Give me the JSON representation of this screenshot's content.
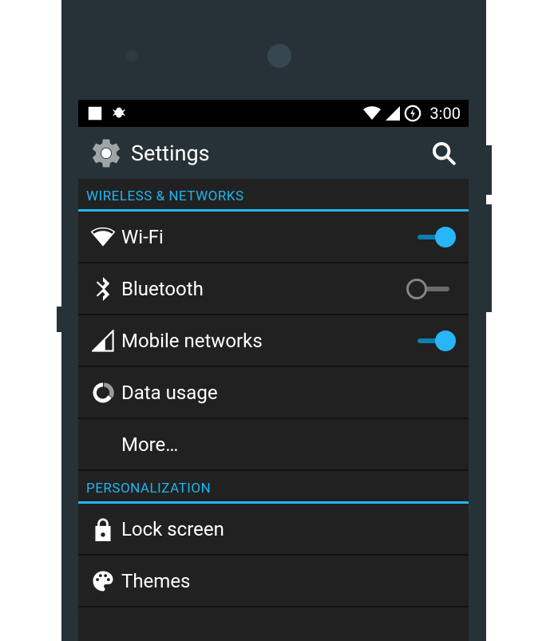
{
  "status_bar": {
    "time": "3:00",
    "icons": {
      "image": "image-icon",
      "debug": "bug-icon",
      "wifi": "wifi-signal-icon",
      "cell": "cell-signal-icon",
      "power": "power-circle-icon"
    }
  },
  "app_bar": {
    "title": "Settings",
    "icon": "gear-icon",
    "search_icon": "search-icon"
  },
  "sections": [
    {
      "header": "WIRELESS & NETWORKS",
      "items": [
        {
          "icon": "wifi-icon",
          "label": "Wi-Fi",
          "toggle": true,
          "toggle_on": true
        },
        {
          "icon": "bluetooth-icon",
          "label": "Bluetooth",
          "toggle": true,
          "toggle_on": false
        },
        {
          "icon": "cell-icon",
          "label": "Mobile networks",
          "toggle": true,
          "toggle_on": true
        },
        {
          "icon": "data-usage-icon",
          "label": "Data usage",
          "toggle": false
        },
        {
          "icon": null,
          "label": "More…",
          "toggle": false
        }
      ]
    },
    {
      "header": "PERSONALIZATION",
      "items": [
        {
          "icon": "lock-icon",
          "label": "Lock screen",
          "toggle": false
        },
        {
          "icon": "palette-icon",
          "label": "Themes",
          "toggle": false
        }
      ]
    }
  ],
  "colors": {
    "accent": "#29b6f6",
    "header_text": "#1fb6f0",
    "bg": "#212121",
    "app_bar_bg": "#263238"
  }
}
